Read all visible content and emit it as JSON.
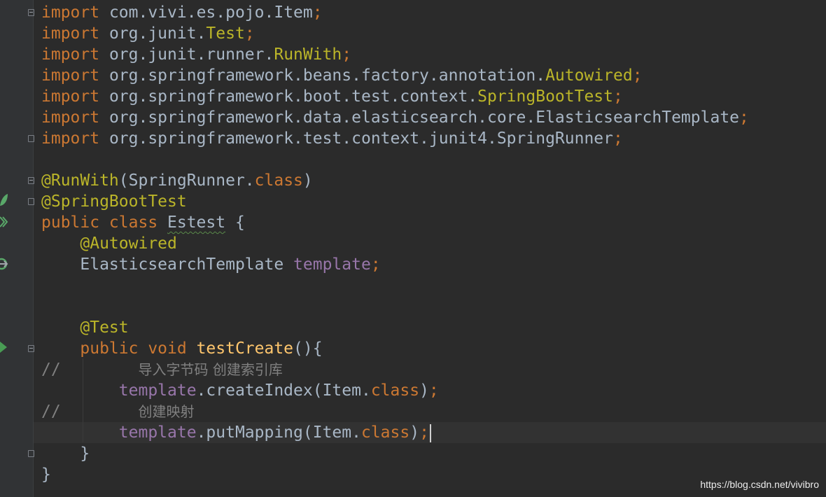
{
  "code_lines": [
    [
      {
        "t": "import",
        "c": "kw"
      },
      {
        "t": " com.vivi.es.pojo.Item"
      },
      {
        "t": ";",
        "c": "kw"
      }
    ],
    [
      {
        "t": "import",
        "c": "kw"
      },
      {
        "t": " org.junit."
      },
      {
        "t": "Test",
        "c": "ann"
      },
      {
        "t": ";",
        "c": "kw"
      }
    ],
    [
      {
        "t": "import",
        "c": "kw"
      },
      {
        "t": " org.junit.runner."
      },
      {
        "t": "RunWith",
        "c": "ann"
      },
      {
        "t": ";",
        "c": "kw"
      }
    ],
    [
      {
        "t": "import",
        "c": "kw"
      },
      {
        "t": " org.springframework.beans.factory.annotation."
      },
      {
        "t": "Autowired",
        "c": "ann"
      },
      {
        "t": ";",
        "c": "kw"
      }
    ],
    [
      {
        "t": "import",
        "c": "kw"
      },
      {
        "t": " org.springframework.boot.test.context."
      },
      {
        "t": "SpringBootTest",
        "c": "ann"
      },
      {
        "t": ";",
        "c": "kw"
      }
    ],
    [
      {
        "t": "import",
        "c": "kw"
      },
      {
        "t": " org.springframework.data.elasticsearch.core.ElasticsearchTemplate"
      },
      {
        "t": ";",
        "c": "kw"
      }
    ],
    [
      {
        "t": "import",
        "c": "kw"
      },
      {
        "t": " org.springframework.test.context.junit4.SpringRunner"
      },
      {
        "t": ";",
        "c": "kw"
      }
    ],
    [],
    [
      {
        "t": "@RunWith",
        "c": "ann"
      },
      {
        "t": "(SpringRunner."
      },
      {
        "t": "class",
        "c": "kw"
      },
      {
        "t": ")"
      }
    ],
    [
      {
        "t": "@SpringBootTest",
        "c": "ann"
      }
    ],
    [
      {
        "t": "public class ",
        "c": "kw"
      },
      {
        "t": "Estest",
        "c": "typo"
      },
      {
        "t": " {"
      }
    ],
    [
      {
        "t": "    "
      },
      {
        "t": "@Autowired",
        "c": "ann"
      }
    ],
    [
      {
        "t": "    ElasticsearchTemplate "
      },
      {
        "t": "template",
        "c": "fld"
      },
      {
        "t": ";",
        "c": "kw"
      }
    ],
    [],
    [],
    [
      {
        "t": "    "
      },
      {
        "t": "@Test",
        "c": "ann"
      }
    ],
    [
      {
        "t": "    "
      },
      {
        "t": "public void ",
        "c": "kw"
      },
      {
        "t": "testCreate",
        "c": "fn"
      },
      {
        "t": "(){"
      }
    ],
    [
      {
        "t": "//        ",
        "c": "cmt"
      },
      {
        "t": "导入字节码 创建索引库",
        "c": "cmt cjk"
      }
    ],
    [
      {
        "t": "        "
      },
      {
        "t": "template",
        "c": "fld"
      },
      {
        "t": ".createIndex(Item."
      },
      {
        "t": "class",
        "c": "kw"
      },
      {
        "t": ")"
      },
      {
        "t": ";",
        "c": "kw"
      }
    ],
    [
      {
        "t": "//        ",
        "c": "cmt"
      },
      {
        "t": "创建映射",
        "c": "cmt cjk"
      }
    ],
    [
      {
        "t": "        "
      },
      {
        "t": "template",
        "c": "fld"
      },
      {
        "t": ".putMapping(Item."
      },
      {
        "t": "class",
        "c": "kw"
      },
      {
        "t": ")"
      },
      {
        "t": ";",
        "c": "kw"
      },
      {
        "caret": true
      }
    ],
    [
      {
        "t": "    }"
      }
    ],
    [
      {
        "t": "}"
      }
    ]
  ],
  "gutter": {
    "icons": [
      "spring-bean-icon",
      "run-class-icon",
      "autowired-navigate-icon",
      "run-test-icon"
    ],
    "fold_markers": [
      "fold-start",
      "fold-end",
      "fold-start",
      "fold-end",
      "fold-start",
      "fold-end"
    ]
  },
  "watermark": "https://blog.csdn.net/vivibro",
  "colors": {
    "background": "#2b2b2b",
    "gutter": "#313335",
    "keyword": "#cc7832",
    "annotation": "#bbb529",
    "field": "#9876aa",
    "method": "#ffc66d",
    "comment": "#808080",
    "text": "#a9b7c6",
    "gutter_icon_green": "#59a869"
  }
}
